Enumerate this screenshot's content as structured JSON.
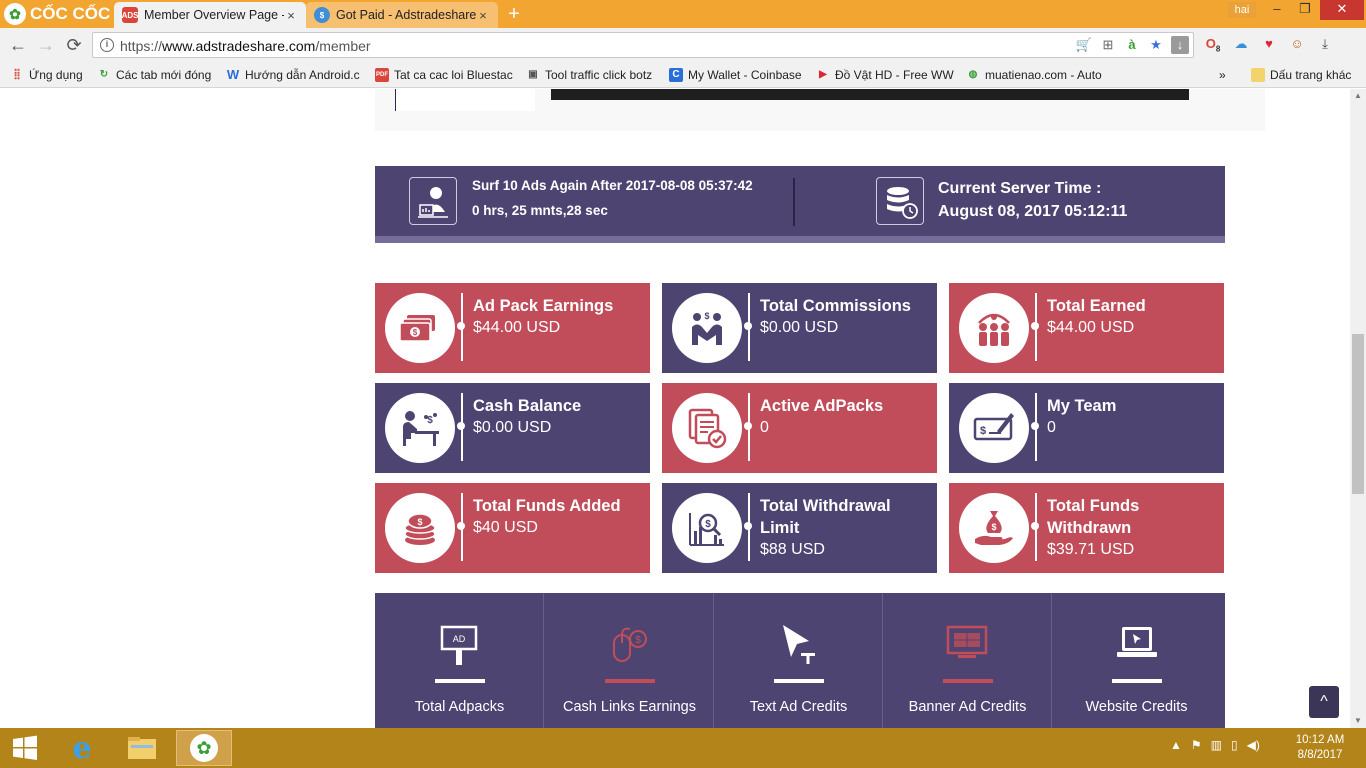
{
  "browser": {
    "brand": "CỐC CỐC",
    "tabs": [
      {
        "title": "Member Overview Page -",
        "close": "×",
        "active": true
      },
      {
        "title": "Got Paid - Adstradeshare",
        "close": "×",
        "active": false
      }
    ],
    "new_tab": "+",
    "user": "hai",
    "window_controls": {
      "minimize": "–",
      "maximize": "❐",
      "close": "✕"
    },
    "url_scheme": "https://",
    "url_host": "www.adstradeshare.com",
    "url_path": "/member",
    "bookmarks": [
      {
        "label": "Ứng dụng",
        "icon": "apps-grid-icon"
      },
      {
        "label": "Các tab mới đóng",
        "icon": "recent-tabs-icon"
      },
      {
        "label": "Hướng dẫn Android.c",
        "icon": "w-icon"
      },
      {
        "label": "Tat ca cac loi Bluestac",
        "icon": "pdf-icon"
      },
      {
        "label": "Tool traffic click botz",
        "icon": "puzzle-icon"
      },
      {
        "label": "My Wallet - Coinbase",
        "icon": "coinbase-icon"
      },
      {
        "label": "Đồ Vật HD - Free WW",
        "icon": "play-icon"
      },
      {
        "label": "muatienao.com - Auto",
        "icon": "globe-icon"
      }
    ],
    "bookmarks_overflow": "»",
    "other_bookmarks": "Dấu trang khác",
    "ext_badge": "8"
  },
  "status": {
    "surf_line1": "Surf 10 Ads Again After 2017-08-08 05:37:42",
    "surf_line2": "0 hrs, 25 mnts,28 sec",
    "server_line1": "Current Server Time :",
    "server_line2": "August 08, 2017 05:12:11"
  },
  "cards": [
    {
      "title": "Ad Pack Earnings",
      "value": "$44.00 USD",
      "color": "#c14d5a",
      "icon": "money-stack-icon"
    },
    {
      "title": "Total Commissions",
      "value": "$0.00 USD",
      "color": "#4d4472",
      "icon": "handshake-icon"
    },
    {
      "title": "Total Earned",
      "value": "$44.00 USD",
      "color": "#c14d5a",
      "icon": "team-earnings-icon"
    },
    {
      "title": "Cash Balance",
      "value": "$0.00 USD",
      "color": "#4d4472",
      "icon": "desk-worker-icon"
    },
    {
      "title": "Active AdPacks",
      "value": "0",
      "color": "#c14d5a",
      "icon": "checked-documents-icon"
    },
    {
      "title": "My Team",
      "value": "0",
      "color": "#4d4472",
      "icon": "cheque-icon"
    },
    {
      "title": "Total Funds Added",
      "value": "$40 USD",
      "color": "#c14d5a",
      "icon": "coin-stack-icon"
    },
    {
      "title": "Total Withdrawal Limit",
      "value": "$88 USD",
      "color": "#4d4472",
      "icon": "chart-magnifier-icon"
    },
    {
      "title": "Total Funds Withdrawn",
      "value": "$39.71 USD",
      "color": "#c14d5a",
      "icon": "hand-money-bag-icon"
    }
  ],
  "credits": [
    {
      "label": "Total Adpacks",
      "icon": "ad-sign-icon",
      "accent": "#ffffff"
    },
    {
      "label": "Cash Links Earnings",
      "icon": "mouse-dollar-icon",
      "accent": "#c14d5a"
    },
    {
      "label": "Text Ad Credits",
      "icon": "cursor-text-icon",
      "accent": "#ffffff"
    },
    {
      "label": "Banner Ad Credits",
      "icon": "banner-screen-icon",
      "accent": "#c14d5a"
    },
    {
      "label": "Website Credits",
      "icon": "laptop-icon",
      "accent": "#ffffff"
    }
  ],
  "back_to_top": "^",
  "taskbar": {
    "time": "10:12 AM",
    "date": "8/8/2017"
  }
}
